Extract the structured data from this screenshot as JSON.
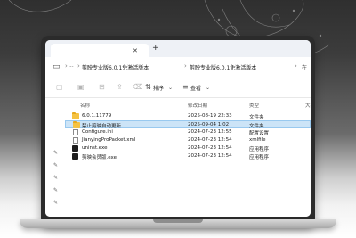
{
  "colors": {
    "folder": "#f5c242",
    "selection": "#cce4f7",
    "bezel": "#2b2b2b"
  },
  "tab": {
    "close_icon": "close-icon",
    "new_tab": "+"
  },
  "address": {
    "crumbs": [
      "剪映专业版6.0.1免激活版本",
      "剪映专业版6.0.1免激活版本"
    ],
    "separator": "›",
    "search_placeholder": "在"
  },
  "toolbar": {
    "sort_label": "排序",
    "view_label": "查看",
    "more_label": "···"
  },
  "columns": {
    "name": "名称",
    "date": "修改日期",
    "type": "类型",
    "size": "大小"
  },
  "files": [
    {
      "name": "6.0.1.11779",
      "date": "2025-08-19 22:33",
      "type": "文件夹",
      "icon": "folder-icon",
      "selected": false
    },
    {
      "name": "禁止剪映自动更新",
      "date": "2025-09-04 1:02",
      "type": "文件夹",
      "icon": "folder-icon",
      "selected": true
    },
    {
      "name": "Configure.ini",
      "date": "2024-07-23 12:55",
      "type": "配置设置",
      "icon": "settings-file-icon",
      "selected": false
    },
    {
      "name": "JianyingProPacket.xml",
      "date": "2024-07-23 12:54",
      "type": "xmlfile",
      "icon": "document-icon",
      "selected": false
    },
    {
      "name": "uninst.exe",
      "date": "2024-07-23 12:54",
      "type": "应用程序",
      "icon": "app-icon",
      "selected": false
    },
    {
      "name": "剪映会员版.exe",
      "date": "2024-07-23 12:54",
      "type": "应用程序",
      "icon": "app-icon",
      "selected": false
    }
  ]
}
